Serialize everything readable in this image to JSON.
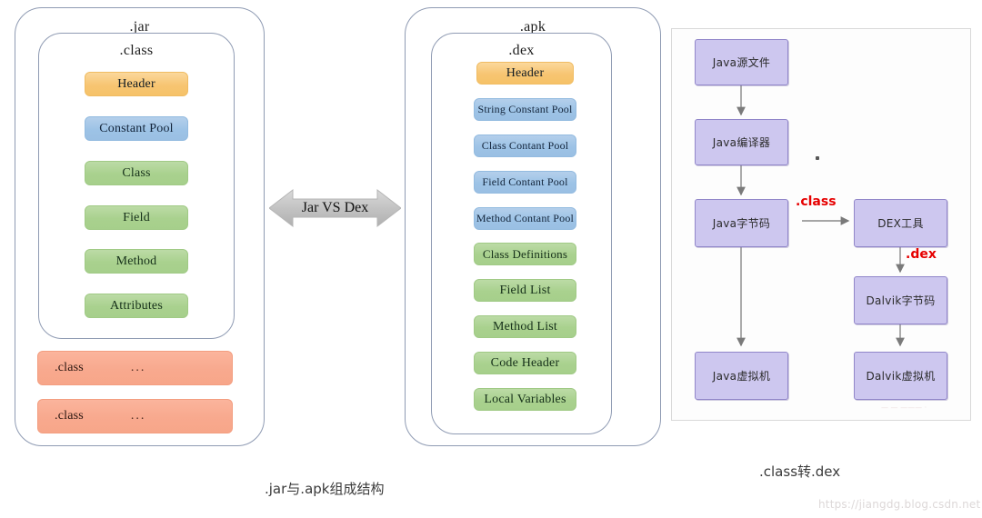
{
  "jar_panel": {
    "outer_title": ".jar",
    "inner_title": ".class",
    "sections": [
      {
        "label": "Header",
        "color": "#F7C572"
      },
      {
        "label": "Constant Pool",
        "color": "#9DC3E6"
      },
      {
        "label": "Class",
        "color": "#A9D18E"
      },
      {
        "label": "Field",
        "color": "#A9D18E"
      },
      {
        "label": "Method",
        "color": "#A9D18E"
      },
      {
        "label": "Attributes",
        "color": "#A9D18E"
      }
    ],
    "extra_classes": [
      {
        "label": ".class",
        "dots": "..."
      },
      {
        "label": ".class",
        "dots": "..."
      }
    ]
  },
  "divider": {
    "label": "Jar VS Dex",
    "arrow_icon": "double-arrow-horizontal-icon",
    "color": "#BFBFBF"
  },
  "apk_panel": {
    "outer_title": ".apk",
    "inner_title": ".dex",
    "sections": [
      {
        "label": "Header",
        "color": "#F7C572"
      },
      {
        "label": "String Constant Pool",
        "color": "#9DC3E6"
      },
      {
        "label": "Class Contant Pool",
        "color": "#9DC3E6"
      },
      {
        "label": "Field Contant Pool",
        "color": "#9DC3E6"
      },
      {
        "label": "Method Contant Pool",
        "color": "#9DC3E6"
      },
      {
        "label": "Class Definitions",
        "color": "#A9D18E"
      },
      {
        "label": "Field List",
        "color": "#A9D18E"
      },
      {
        "label": "Method List",
        "color": "#A9D18E"
      },
      {
        "label": "Code Header",
        "color": "#A9D18E"
      },
      {
        "label": "Local Variables",
        "color": "#A9D18E"
      }
    ]
  },
  "flow_panel": {
    "node_color": "#CDC7EF",
    "node_border": "#9186C9",
    "edge_label_color": "#E60000",
    "nodes": [
      {
        "id": "java-source",
        "label": "Java源文件"
      },
      {
        "id": "java-compiler",
        "label": "Java编译器"
      },
      {
        "id": "java-bytecode",
        "label": "Java字节码"
      },
      {
        "id": "dex-tool",
        "label": "DEX工具"
      },
      {
        "id": "dalvik-bytecode",
        "label": "Dalvik字节码"
      },
      {
        "id": "java-vm",
        "label": "Java虚拟机"
      },
      {
        "id": "dalvik-vm",
        "label": "Dalvik虚拟机"
      }
    ],
    "edge_labels": [
      {
        "id": "class-edge",
        "label": ".class"
      },
      {
        "id": "dex-edge",
        "label": ".dex"
      }
    ]
  },
  "captions": {
    "left": ".jar与.apk组成结构",
    "right": ".class转.dex"
  },
  "watermark": "https://jiangdg.blog.csdn.net"
}
